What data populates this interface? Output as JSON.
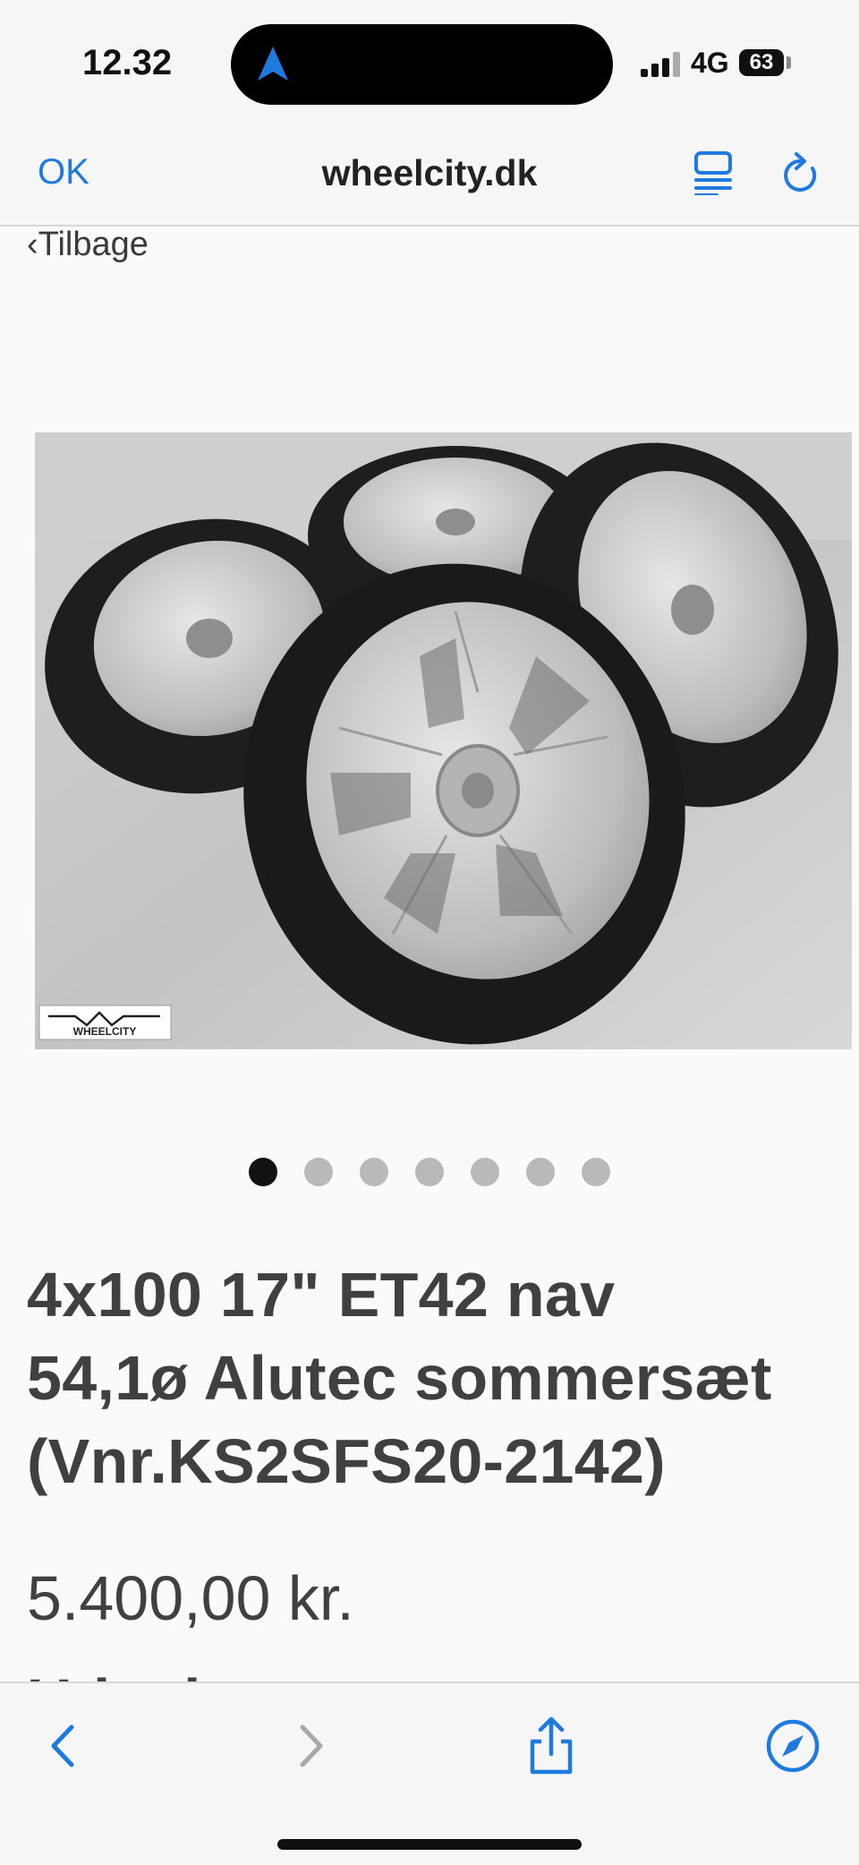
{
  "status_bar": {
    "time": "12.32",
    "network": "4G",
    "battery": "63"
  },
  "browser": {
    "done_label": "OK",
    "url": "wheelcity.dk"
  },
  "page": {
    "back_label": "‹Tilbage",
    "image": {
      "watermark_text": "WHEELCITY",
      "current_slide": 1,
      "slide_count": 7
    },
    "product_title_lines": [
      "4x100 17\" ET42 nav",
      "54,1ø Alutec sommersæt",
      "(Vnr.KS2SFS20-2142)"
    ],
    "price": "5.400,00 kr.",
    "cutoff_text": "Udsolgt"
  },
  "toolbar_icons": [
    "back-icon",
    "forward-icon",
    "share-icon",
    "compass-icon"
  ],
  "colors": {
    "accent": "#1f7ae0",
    "text": "#404040",
    "bar_bg": "#f6f6f6"
  }
}
